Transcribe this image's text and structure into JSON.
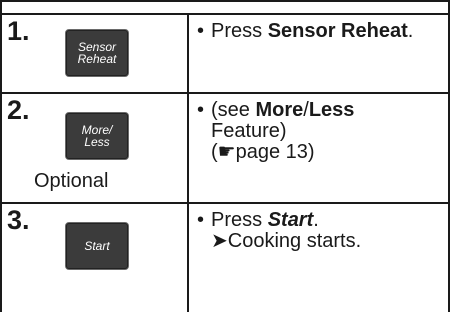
{
  "steps": [
    {
      "number": "1.",
      "key": {
        "line1": "Sensor",
        "line2": "Reheat"
      },
      "instruction": {
        "bullet": "•",
        "prefix": "Press ",
        "emphasis": "Sensor Reheat",
        "suffix": "."
      }
    },
    {
      "number": "2.",
      "key": {
        "line1": "More/",
        "line2": "Less"
      },
      "optional_label": "Optional",
      "instruction": {
        "bullet": "•",
        "line1_prefix": "(see ",
        "more": "More",
        "slash": "/",
        "less": "Less",
        "line2": "Feature)",
        "line3_open": "(",
        "hand_icon": "☛",
        "page_ref": "page 13)"
      }
    },
    {
      "number": "3.",
      "key": {
        "line1": "Start"
      },
      "instruction": {
        "bullet": "•",
        "prefix": "Press ",
        "emphasis": "Start",
        "suffix": ".",
        "arrow": "➤",
        "result": "Cooking starts."
      }
    }
  ]
}
